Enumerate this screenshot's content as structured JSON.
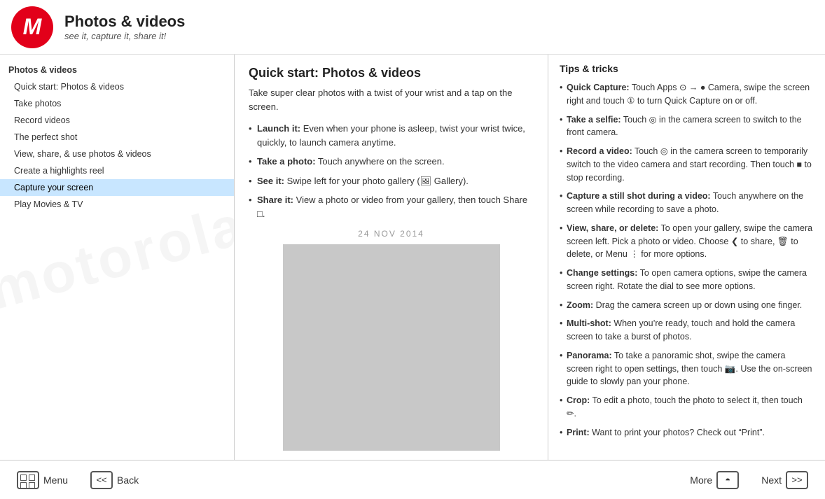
{
  "header": {
    "logo_letter": "M",
    "title": "Photos & videos",
    "subtitle": "see it, capture it, share it!"
  },
  "sidebar": {
    "items": [
      {
        "label": "Photos & videos",
        "level": "top",
        "bold": true,
        "active": false
      },
      {
        "label": "Quick start: Photos & videos",
        "level": "sub",
        "bold": false,
        "active": false
      },
      {
        "label": "Take photos",
        "level": "sub",
        "bold": false,
        "active": false
      },
      {
        "label": "Record videos",
        "level": "sub",
        "bold": false,
        "active": false
      },
      {
        "label": "The perfect shot",
        "level": "sub",
        "bold": false,
        "active": false
      },
      {
        "label": "View, share, & use photos & videos",
        "level": "sub",
        "bold": false,
        "active": false
      },
      {
        "label": "Create a highlights reel",
        "level": "sub",
        "bold": false,
        "active": false
      },
      {
        "label": "Capture your screen",
        "level": "sub",
        "bold": false,
        "active": false,
        "highlighted": true
      },
      {
        "label": "Play Movies & TV",
        "level": "sub",
        "bold": false,
        "active": false
      }
    ]
  },
  "main": {
    "title": "Quick start: Photos & videos",
    "intro": "Take super clear photos with a twist of your wrist and a tap on the screen.",
    "bullets": [
      {
        "label": "Launch it:",
        "text": "Even when your phone is asleep, twist your wrist twice, quickly, to launch camera anytime."
      },
      {
        "label": "Take a photo:",
        "text": "Touch anywhere on the screen."
      },
      {
        "label": "See it:",
        "text": "Swipe left for your photo gallery (🖼 Gallery)."
      },
      {
        "label": "Share it:",
        "text": "View a photo or video from your gallery, then touch Share □."
      }
    ],
    "photo_date": "24 NOV 2014"
  },
  "tips": {
    "heading": "Tips & tricks",
    "items": [
      {
        "label": "Quick Capture:",
        "text": "Touch Apps ⊙ → ● Camera, swipe the screen right and touch ① to turn Quick Capture on or off."
      },
      {
        "label": "Take a selfie:",
        "text": "Touch ◎ in the camera screen to switch to the front camera."
      },
      {
        "label": "Record a video:",
        "text": "Touch ◎ in the camera screen to temporarily switch to the video camera and start recording. Then touch ■ to stop recording."
      },
      {
        "label": "Capture a still shot during a video:",
        "text": "Touch anywhere on the screen while recording to save a photo."
      },
      {
        "label": "View, share, or delete:",
        "text": "To open your gallery, swipe the camera screen left. Pick a photo or video. Choose ❮ to share, 🗑 to delete, or Menu ⋮ for more options."
      },
      {
        "label": "Change settings:",
        "text": "To open camera options, swipe the camera screen right. Rotate the dial to see more options."
      },
      {
        "label": "Zoom:",
        "text": "Drag the camera screen up or down using one finger."
      },
      {
        "label": "Multi-shot:",
        "text": "When you’re ready, touch and hold the camera screen to take a burst of photos."
      },
      {
        "label": "Panorama:",
        "text": "To take a panoramic shot, swipe the camera screen right to open settings, then touch 📷. Use the on-screen guide to slowly pan your phone."
      },
      {
        "label": "Crop:",
        "text": "To edit a photo, touch the photo to select it, then touch ✏."
      },
      {
        "label": "Print:",
        "text": "Want to print your photos? Check out “Print”."
      }
    ]
  },
  "footer": {
    "menu_label": "Menu",
    "more_label": "More",
    "back_label": "Back",
    "next_label": "Next"
  }
}
